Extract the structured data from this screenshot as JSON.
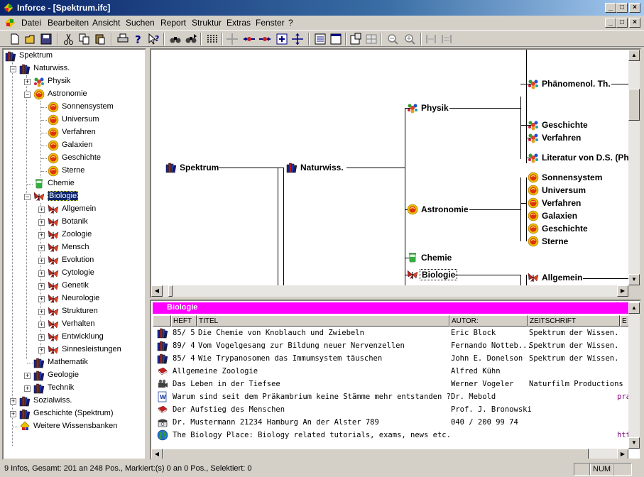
{
  "window": {
    "title": "Inforce - [Spektrum.ifc]",
    "controls": [
      "_",
      "□",
      "×"
    ]
  },
  "menu": [
    "Datei",
    "Bearbeiten",
    "Ansicht",
    "Suchen",
    "Report",
    "Struktur",
    "Extras",
    "Fenster",
    "?"
  ],
  "toolbar_icons": [
    "new-icon",
    "open-icon",
    "save-icon",
    "cut-icon",
    "copy-icon",
    "paste-icon",
    "print-icon",
    "help-icon",
    "context-help-icon",
    "find-icon",
    "find-next-icon",
    "columns-icon",
    "move-icon",
    "link-left-icon",
    "link-right-icon",
    "expand-icon",
    "collapse-icon",
    "list-view-icon",
    "text-view-icon",
    "properties-icon",
    "layout-icon",
    "zoom-out-icon",
    "zoom-in-icon",
    "prev-icon",
    "next-icon"
  ],
  "tree": [
    {
      "label": "Spektrum",
      "icon": "books-icon",
      "level": 0,
      "pm": ""
    },
    {
      "label": "Naturwiss.",
      "icon": "books-icon",
      "level": 1,
      "pm": "-"
    },
    {
      "label": "Physik",
      "icon": "atom-icon",
      "level": 2,
      "pm": "+"
    },
    {
      "label": "Astronomie",
      "icon": "sun-icon",
      "level": 2,
      "pm": "-"
    },
    {
      "label": "Sonnensystem",
      "icon": "sun-icon",
      "level": 3,
      "pm": ""
    },
    {
      "label": "Universum",
      "icon": "sun-icon",
      "level": 3,
      "pm": ""
    },
    {
      "label": "Verfahren",
      "icon": "sun-icon",
      "level": 3,
      "pm": ""
    },
    {
      "label": "Galaxien",
      "icon": "sun-icon",
      "level": 3,
      "pm": ""
    },
    {
      "label": "Geschichte",
      "icon": "sun-icon",
      "level": 3,
      "pm": ""
    },
    {
      "label": "Sterne",
      "icon": "sun-icon",
      "level": 3,
      "pm": ""
    },
    {
      "label": "Chemie",
      "icon": "beaker-icon",
      "level": 2,
      "pm": ""
    },
    {
      "label": "Biologie",
      "icon": "butterfly-icon",
      "level": 2,
      "pm": "-",
      "selected": true
    },
    {
      "label": "Allgemein",
      "icon": "butterfly-icon",
      "level": 3,
      "pm": "+"
    },
    {
      "label": "Botanik",
      "icon": "butterfly-icon",
      "level": 3,
      "pm": "+"
    },
    {
      "label": "Zoologie",
      "icon": "butterfly-icon",
      "level": 3,
      "pm": "+"
    },
    {
      "label": "Mensch",
      "icon": "butterfly-icon",
      "level": 3,
      "pm": "+"
    },
    {
      "label": "Evolution",
      "icon": "butterfly-icon",
      "level": 3,
      "pm": "+"
    },
    {
      "label": "Cytologie",
      "icon": "butterfly-icon",
      "level": 3,
      "pm": "+"
    },
    {
      "label": "Genetik",
      "icon": "butterfly-icon",
      "level": 3,
      "pm": "+"
    },
    {
      "label": "Neurologie",
      "icon": "butterfly-icon",
      "level": 3,
      "pm": "+"
    },
    {
      "label": "Strukturen",
      "icon": "butterfly-icon",
      "level": 3,
      "pm": "+"
    },
    {
      "label": "Verhalten",
      "icon": "butterfly-icon",
      "level": 3,
      "pm": "+"
    },
    {
      "label": "Entwicklung",
      "icon": "butterfly-icon",
      "level": 3,
      "pm": "+"
    },
    {
      "label": "Sinnesleistungen",
      "icon": "butterfly-icon",
      "level": 3,
      "pm": "+"
    },
    {
      "label": "Mathematik",
      "icon": "books-icon",
      "level": 2,
      "pm": ""
    },
    {
      "label": "Geologie",
      "icon": "books-icon",
      "level": 2,
      "pm": "+"
    },
    {
      "label": "Technik",
      "icon": "books-icon",
      "level": 2,
      "pm": "+"
    },
    {
      "label": "Sozialwiss.",
      "icon": "books-icon",
      "level": 1,
      "pm": "+"
    },
    {
      "label": "Geschichte (Spektrum)",
      "icon": "books-icon",
      "level": 1,
      "pm": "+"
    },
    {
      "label": "Weitere Wissensbanken",
      "icon": "knowledge-icon",
      "level": 1,
      "pm": ""
    }
  ],
  "graph": {
    "root": "Spektrum",
    "naturwiss": "Naturwiss.",
    "physik": "Physik",
    "astronomie": "Astronomie",
    "chemie": "Chemie",
    "biologie": "Biologie",
    "physik_children": [
      "Phänomenol. Th.",
      "Geschichte",
      "Verfahren",
      "Literatur von D.S. (Ph"
    ],
    "astro_children": [
      "Sonnensystem",
      "Universum",
      "Verfahren",
      "Galaxien",
      "Geschichte",
      "Sterne"
    ],
    "bio_children": [
      "Allgemein"
    ]
  },
  "list": {
    "header": "Biologie",
    "columns": [
      "",
      "HEFT",
      "TITEL",
      "AUTOR:",
      "ZEITSCHRIFT",
      "E"
    ],
    "rows": [
      {
        "icon": "books-icon",
        "heft": "85/ 5",
        "titel": "Die Chemie von Knoblauch und Zwiebeln",
        "autor": "Eric Block",
        "zeitschrift": "Spektrum der Wissen.",
        "extra": ""
      },
      {
        "icon": "books-icon",
        "heft": "89/ 4",
        "titel": "Vom Vogelgesang zur Bildung neuer Nervenzellen",
        "autor": "Fernando Notteb...",
        "zeitschrift": "Spektrum der Wissen.",
        "extra": ""
      },
      {
        "icon": "books-icon",
        "heft": "85/ 4",
        "titel": "Wie Trypanosomen das  Immumsystem täuschen",
        "autor": "John E. Donelson",
        "zeitschrift": "Spektrum der Wissen.",
        "extra": ""
      },
      {
        "icon": "book-red-icon",
        "heft": "",
        "titel": "Allgemeine Zoologie",
        "autor": "Alfred Kühn",
        "zeitschrift": "",
        "extra": ""
      },
      {
        "icon": "film-icon",
        "heft": "",
        "titel": "Das Leben in der Tiefsee",
        "autor": "Werner Vogeler",
        "zeitschrift": "Naturfilm Productions",
        "extra": ""
      },
      {
        "icon": "word-doc-icon",
        "heft": "",
        "titel": "Warum sind seit dem Präkambrium keine Stämme mehr entstanden ?",
        "autor": "Dr. Mebold",
        "zeitschrift": "",
        "extra": "pra"
      },
      {
        "icon": "book-red-icon",
        "heft": "",
        "titel": "Der Aufstieg des Menschen",
        "autor": "Prof. J. Bronowski",
        "zeitschrift": "",
        "extra": ""
      },
      {
        "icon": "phone-icon",
        "heft": "",
        "titel": "Dr. Mustermann          21234 Hamburg      An der Alster 789",
        "autor": "040 / 200 99 74",
        "zeitschrift": "",
        "extra": ""
      },
      {
        "icon": "globe-icon",
        "heft": "",
        "titel": "The Biology Place: Biology related tutorials, exams, news etc.",
        "autor": "",
        "zeitschrift": "",
        "extra": "http"
      }
    ]
  },
  "status": {
    "text": "9 Infos,  Gesamt: 201 an 248 Pos.,  Markiert:(s) 0 an 0 Pos., Selektiert: 0",
    "num": "NUM"
  },
  "colors": {
    "titlebar": "#0a246a",
    "list_header": "#ff00ff",
    "selection": "#0a246a"
  }
}
